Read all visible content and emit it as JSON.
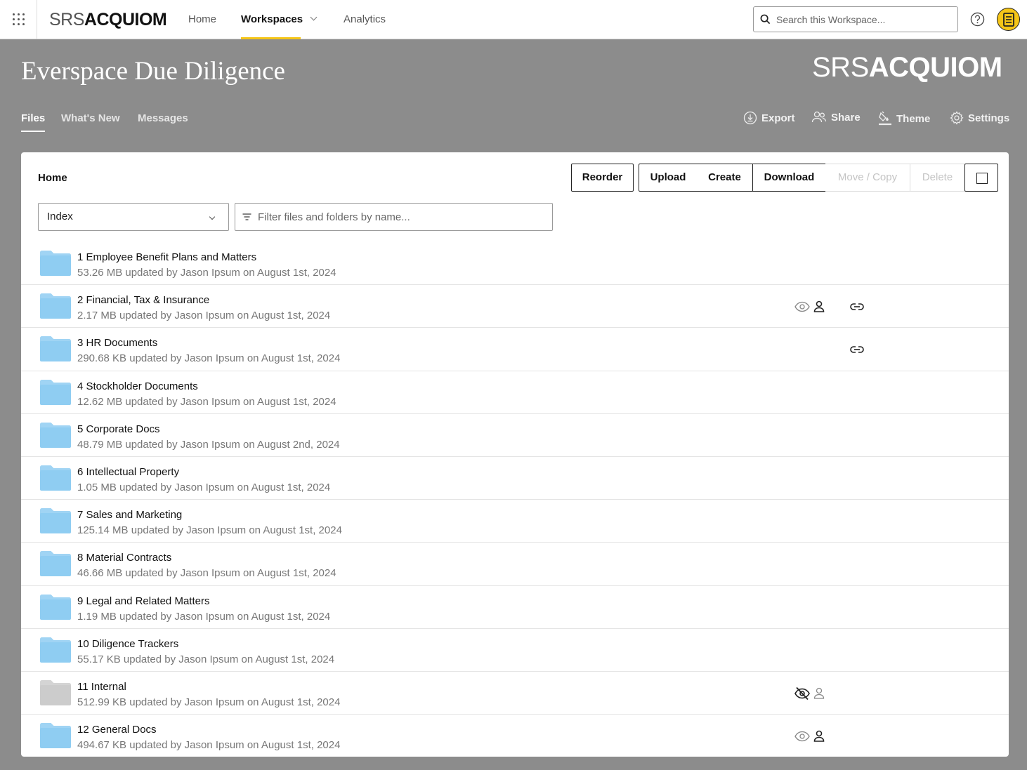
{
  "topnav": {
    "logo_srs": "SRS",
    "logo_acquiom": "ACQUIOM",
    "links": [
      {
        "label": "Home"
      },
      {
        "label": "Workspaces"
      },
      {
        "label": "Analytics"
      }
    ],
    "search_placeholder": "Search this Workspace..."
  },
  "header": {
    "title": "Everspace Due Diligence",
    "logo_srs": "SRS",
    "logo_acquiom": "ACQUIOM",
    "tabs": [
      {
        "label": "Files"
      },
      {
        "label": "What's New"
      },
      {
        "label": "Messages"
      }
    ],
    "actions": [
      {
        "label": "Export",
        "icon": "export-icon"
      },
      {
        "label": "Share",
        "icon": "share-icon"
      },
      {
        "label": "Theme",
        "icon": "theme-icon"
      },
      {
        "label": "Settings",
        "icon": "gear-icon"
      }
    ]
  },
  "panel": {
    "breadcrumb": "Home",
    "buttons": {
      "reorder": "Reorder",
      "upload": "Upload",
      "create": "Create",
      "download": "Download",
      "move_copy": "Move / Copy",
      "delete": "Delete"
    },
    "view_select": "Index",
    "filter_placeholder": "Filter files and folders by name..."
  },
  "folders": [
    {
      "name": "1 Employee Benefit Plans and Matters",
      "meta": "53.26 MB updated by Jason Ipsum on August 1st, 2024",
      "color": "#8fcdf2",
      "visibility": "",
      "link": false
    },
    {
      "name": "2 Financial, Tax & Insurance",
      "meta": "2.17 MB updated by Jason Ipsum on August 1st, 2024",
      "color": "#8fcdf2",
      "visibility": "visible",
      "link": true
    },
    {
      "name": "3 HR Documents",
      "meta": "290.68 KB updated by Jason Ipsum on August 1st, 2024",
      "color": "#8fcdf2",
      "visibility": "",
      "link": true
    },
    {
      "name": "4 Stockholder Documents",
      "meta": "12.62 MB updated by Jason Ipsum on August 1st, 2024",
      "color": "#8fcdf2",
      "visibility": "",
      "link": false
    },
    {
      "name": "5 Corporate Docs",
      "meta": "48.79 MB updated by Jason Ipsum on August 2nd, 2024",
      "color": "#8fcdf2",
      "visibility": "",
      "link": false
    },
    {
      "name": "6 Intellectual Property",
      "meta": "1.05 MB updated by Jason Ipsum on August 1st, 2024",
      "color": "#8fcdf2",
      "visibility": "",
      "link": false
    },
    {
      "name": "7 Sales and Marketing",
      "meta": "125.14 MB updated by Jason Ipsum on August 1st, 2024",
      "color": "#8fcdf2",
      "visibility": "",
      "link": false
    },
    {
      "name": "8 Material Contracts",
      "meta": "46.66 MB updated by Jason Ipsum on August 1st, 2024",
      "color": "#8fcdf2",
      "visibility": "",
      "link": false
    },
    {
      "name": "9 Legal and Related Matters",
      "meta": "1.19 MB updated by Jason Ipsum on August 1st, 2024",
      "color": "#8fcdf2",
      "visibility": "",
      "link": false
    },
    {
      "name": "10 Diligence Trackers",
      "meta": "55.17 KB updated by Jason Ipsum on August 1st, 2024",
      "color": "#8fcdf2",
      "visibility": "",
      "link": false
    },
    {
      "name": "11 Internal",
      "meta": "512.99 KB updated by Jason Ipsum on August 1st, 2024",
      "color": "#cccccc",
      "visibility": "hidden",
      "link": false
    },
    {
      "name": "12 General Docs",
      "meta": "494.67 KB updated by Jason Ipsum on August 1st, 2024",
      "color": "#8fcdf2",
      "visibility": "visible",
      "link": false
    }
  ]
}
